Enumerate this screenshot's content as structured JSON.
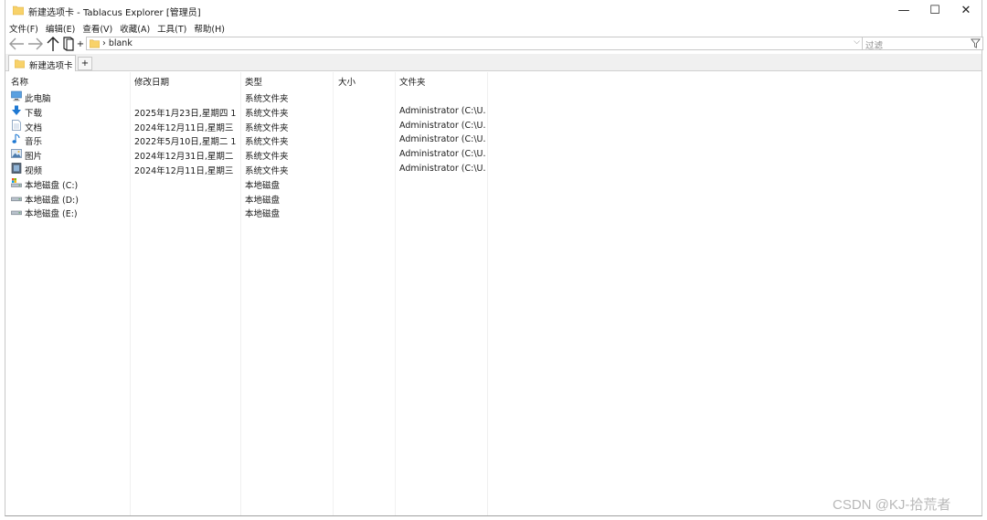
{
  "window": {
    "title": "新建选项卡 - Tablacus Explorer [管理员]",
    "minimize_glyph": "—",
    "maximize_glyph": "☐",
    "close_glyph": "✕"
  },
  "menu": [
    "文件(F)",
    "编辑(E)",
    "查看(V)",
    "收藏(A)",
    "工具(T)",
    "帮助(H)"
  ],
  "toolbar": {
    "back_icon": "arrow-left-icon",
    "forward_icon": "arrow-right-icon",
    "up_icon": "arrow-up-icon",
    "plus": "+",
    "address_text": "› blank",
    "address_dropdown": "⌵",
    "filter_placeholder": "过滤"
  },
  "tabs": {
    "active_label": "新建选项卡",
    "add_label": "+"
  },
  "columns": [
    "名称",
    "修改日期",
    "类型",
    "大小",
    "文件夹"
  ],
  "rows": [
    {
      "icon": "computer-icon",
      "name": "此电脑",
      "date": "",
      "type": "系统文件夹",
      "size": "",
      "folder": ""
    },
    {
      "icon": "download-icon",
      "name": "下载",
      "date": "2025年1月23日,星期四 1...",
      "type": "系统文件夹",
      "size": "",
      "folder": "Administrator (C:\\U..."
    },
    {
      "icon": "document-icon",
      "name": "文档",
      "date": "2024年12月11日,星期三 ...",
      "type": "系统文件夹",
      "size": "",
      "folder": "Administrator (C:\\U..."
    },
    {
      "icon": "music-icon",
      "name": "音乐",
      "date": "2022年5月10日,星期二 1...",
      "type": "系统文件夹",
      "size": "",
      "folder": "Administrator (C:\\U..."
    },
    {
      "icon": "picture-icon",
      "name": "图片",
      "date": "2024年12月31日,星期二 ...",
      "type": "系统文件夹",
      "size": "",
      "folder": "Administrator (C:\\U..."
    },
    {
      "icon": "video-icon",
      "name": "视频",
      "date": "2024年12月11日,星期三 ...",
      "type": "系统文件夹",
      "size": "",
      "folder": "Administrator (C:\\U..."
    },
    {
      "icon": "system-drive-icon",
      "name": "本地磁盘 (C:)",
      "date": "",
      "type": "本地磁盘",
      "size": "",
      "folder": ""
    },
    {
      "icon": "drive-icon",
      "name": "本地磁盘 (D:)",
      "date": "",
      "type": "本地磁盘",
      "size": "",
      "folder": ""
    },
    {
      "icon": "drive-icon",
      "name": "本地磁盘 (E:)",
      "date": "",
      "type": "本地磁盘",
      "size": "",
      "folder": ""
    }
  ],
  "watermark": "CSDN @KJ-拾荒者",
  "colors": {
    "folder": "#f8d26a",
    "accent": "#1e78d2"
  }
}
